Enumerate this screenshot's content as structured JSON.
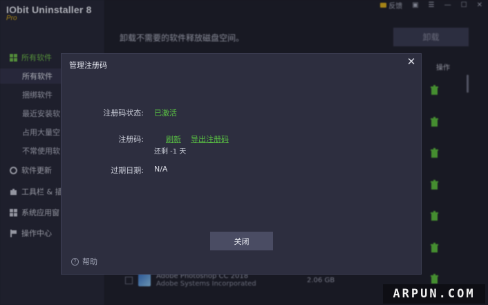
{
  "app": {
    "title": "IObit Uninstaller 8",
    "edition": "Pro",
    "feedback_label": "反馈"
  },
  "sidebar": {
    "groups": [
      {
        "label": "所有软件",
        "icon": "grid-icon"
      },
      {
        "label": "软件更新",
        "icon": "update-icon"
      },
      {
        "label": "工具栏 & 插",
        "icon": "puzzle-icon"
      },
      {
        "label": "系统应用窗",
        "icon": "windows-icon"
      },
      {
        "label": "操作中心",
        "icon": "flag-icon"
      }
    ],
    "items": [
      {
        "label": "所有软件"
      },
      {
        "label": "捆绑软件"
      },
      {
        "label": "最近安装软"
      },
      {
        "label": "占用大量空"
      },
      {
        "label": "不常使用软"
      }
    ]
  },
  "main": {
    "subtitle": "卸载不需要的软件释放磁盘空间。",
    "uninstall_label": "卸载",
    "column_operation": "操作",
    "bottom_row": {
      "name": "Adobe Photoshop CC 2018",
      "vendor": "Adobe Systems Incorporated",
      "size": "2.06 GB"
    }
  },
  "dialog": {
    "title": "管理注册码",
    "status_label": "注册码状态:",
    "status_value": "已激活",
    "code_label": "注册码:",
    "refresh_link": "刷新",
    "export_link": "导出注册码",
    "remaining": "还剩 -1 天",
    "expiry_label": "过期日期:",
    "expiry_value": "N/A",
    "close_button": "关闭",
    "help_label": "帮助"
  },
  "watermark": "ARPUN.COM",
  "colors": {
    "accent_green": "#59c043",
    "brand_yellow": "#e2b318",
    "dialog_bg": "#2d2e3f",
    "sidebar_bg": "#262736"
  }
}
